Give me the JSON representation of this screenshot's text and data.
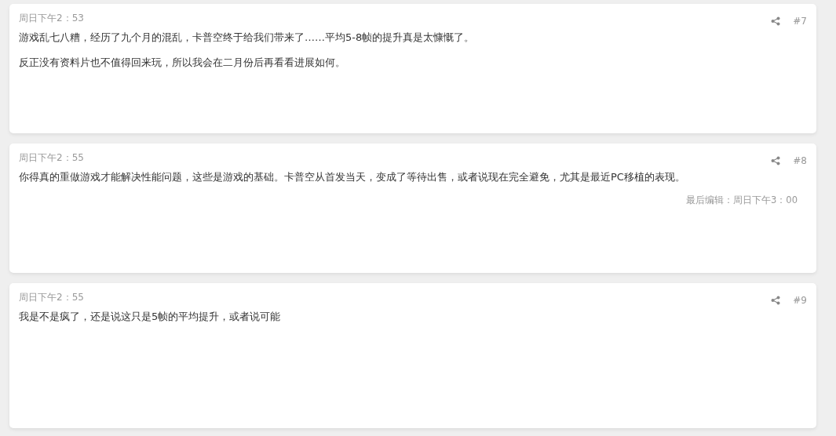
{
  "posts": [
    {
      "time": "周日下午2：53",
      "number": "#7",
      "paragraphs": [
        "游戏乱七八糟，经历了九个月的混乱，卡普空终于给我们带来了……平均5-8帧的提升真是太慷慨了。",
        "反正没有资料片也不值得回来玩，所以我会在二月份后再看看进展如何。"
      ]
    },
    {
      "time": "周日下午2：55",
      "number": "#8",
      "paragraphs": [
        "你得真的重做游戏才能解决性能问题，这些是游戏的基础。卡普空从首发当天，变成了等待出售，或者说现在完全避免，尤其是最近PC移植的表现。"
      ],
      "edited": "最后编辑：周日下午3：00"
    },
    {
      "time": "周日下午2：55",
      "number": "#9",
      "paragraphs": [
        "我是不是疯了，还是说这只是5帧的平均提升，或者说可能"
      ]
    }
  ]
}
